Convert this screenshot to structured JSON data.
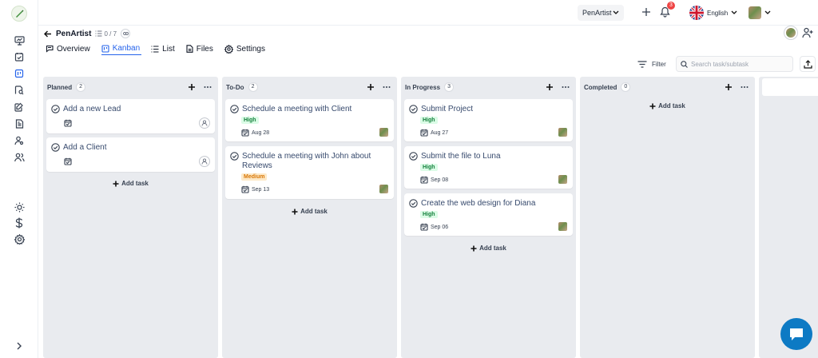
{
  "topbar": {
    "workspace": "PenArtist",
    "notification_count": "3",
    "language": "English"
  },
  "project": {
    "name": "PenArtist",
    "task_count": "0 / 7"
  },
  "tabs": [
    {
      "label": "Overview",
      "icon": "overview-icon"
    },
    {
      "label": "Kanban",
      "icon": "kanban-icon",
      "active": true
    },
    {
      "label": "List",
      "icon": "list-icon"
    },
    {
      "label": "Files",
      "icon": "files-icon"
    },
    {
      "label": "Settings",
      "icon": "settings-icon"
    }
  ],
  "toolbar": {
    "filter_label": "Filter",
    "search_placeholder": "Search task/subtask"
  },
  "board": {
    "add_task_label": "Add task",
    "columns": [
      {
        "title": "Planned",
        "count": "2",
        "cards": [
          {
            "title": "Add a new Lead"
          },
          {
            "title": "Add a Client"
          }
        ]
      },
      {
        "title": "To-Do",
        "count": "2",
        "cards": [
          {
            "title": "Schedule a meeting with Client",
            "priority": "High",
            "date": "Aug 28"
          },
          {
            "title": "Schedule a meeting with John about Reviews",
            "priority": "Medium",
            "date": "Sep 13"
          }
        ]
      },
      {
        "title": "In Progress",
        "count": "3",
        "cards": [
          {
            "title": "Submit Project",
            "priority": "High",
            "date": "Aug 27"
          },
          {
            "title": "Submit the file to Luna",
            "priority": "High",
            "date": "Sep 08"
          },
          {
            "title": "Create the web design for Diana",
            "priority": "High",
            "date": "Sep 06"
          }
        ]
      },
      {
        "title": "Completed",
        "count": "0",
        "cards": []
      }
    ]
  },
  "colors": {
    "accent": "#2563eb",
    "column_bg": "#e9ebef",
    "high_bg": "#dcfce7",
    "high_text": "#15803d",
    "medium_bg": "#fde9c8",
    "medium_text": "#d97706",
    "chat": "#0d7ac4"
  }
}
